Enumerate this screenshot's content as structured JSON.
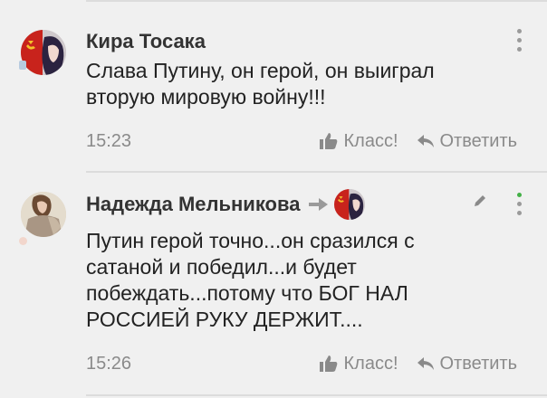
{
  "colors": {
    "background": "#f0f0f0",
    "text": "#222222",
    "meta": "#8a8a8a",
    "online": "#43b047"
  },
  "comments": [
    {
      "author": "Кира Тосака",
      "text": "Слава Путину, он герой, он выиграл вторую мировую войну!!!",
      "time": "15:23",
      "like_label": "Класс!",
      "reply_label": "Ответить",
      "icons": [
        "thumb-up-icon",
        "reply-icon",
        "more-icon"
      ]
    },
    {
      "author": "Надежда Мельникова",
      "text": "Путин герой точно...он сразился с сатаной и победил...и будет побеждать...потому что БОГ НАЛ РОССИЕЙ РУКУ ДЕРЖИТ....",
      "time": "15:26",
      "like_label": "Класс!",
      "reply_label": "Ответить",
      "icons": [
        "reply-to-arrow-icon",
        "thumb-up-icon",
        "reply-icon",
        "edit-icon",
        "more-icon"
      ]
    }
  ]
}
